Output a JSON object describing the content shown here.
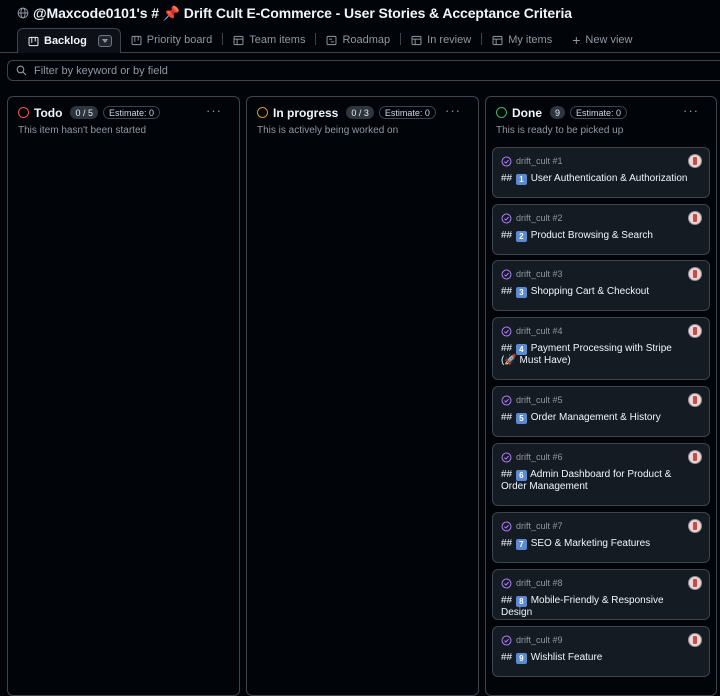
{
  "header": {
    "title": "@Maxcode0101's # 📌 Drift Cult E-Commerce - User Stories & Acceptance Criteria"
  },
  "tabs": [
    {
      "label": "Backlog",
      "icon": "board-icon",
      "active": true
    },
    {
      "label": "Priority board",
      "icon": "board-icon"
    },
    {
      "label": "Team items",
      "icon": "table-icon"
    },
    {
      "label": "Roadmap",
      "icon": "roadmap-icon"
    },
    {
      "label": "In review",
      "icon": "table-icon"
    },
    {
      "label": "My items",
      "icon": "table-icon"
    }
  ],
  "new_view_label": "New view",
  "filter": {
    "placeholder": "Filter by keyword or by field"
  },
  "columns": [
    {
      "name": "Todo",
      "count": "0 / 5",
      "estimate": "Estimate: 0",
      "description": "This item hasn't been started",
      "color": "#f85149"
    },
    {
      "name": "In progress",
      "count": "0 / 3",
      "estimate": "Estimate: 0",
      "description": "This is actively being worked on",
      "color": "#d29922"
    },
    {
      "name": "Done",
      "count": "9",
      "estimate": "Estimate: 0",
      "description": "This is ready to be picked up",
      "color": "#3fb950"
    }
  ],
  "cards": [
    {
      "repo": "drift_cult #1",
      "num": "1",
      "title": "User Authentication & Authorization"
    },
    {
      "repo": "drift_cult #2",
      "num": "2",
      "title": "Product Browsing & Search"
    },
    {
      "repo": "drift_cult #3",
      "num": "3",
      "title": "Shopping Cart & Checkout"
    },
    {
      "repo": "drift_cult #4",
      "num": "4",
      "title": "Payment Processing with Stripe (🚀 Must Have)"
    },
    {
      "repo": "drift_cult #5",
      "num": "5",
      "title": "Order Management & History"
    },
    {
      "repo": "drift_cult #6",
      "num": "6",
      "title": "Admin Dashboard for Product & Order Management"
    },
    {
      "repo": "drift_cult #7",
      "num": "7",
      "title": "SEO & Marketing Features"
    },
    {
      "repo": "drift_cult #8",
      "num": "8",
      "title": "Mobile-Friendly & Responsive Design"
    },
    {
      "repo": "drift_cult #9",
      "num": "9",
      "title": "Wishlist Feature"
    }
  ],
  "card_prefix": "##",
  "colors": {
    "accent_purple": "#ab7df8",
    "border": "#3d444d",
    "background": "#010409"
  }
}
